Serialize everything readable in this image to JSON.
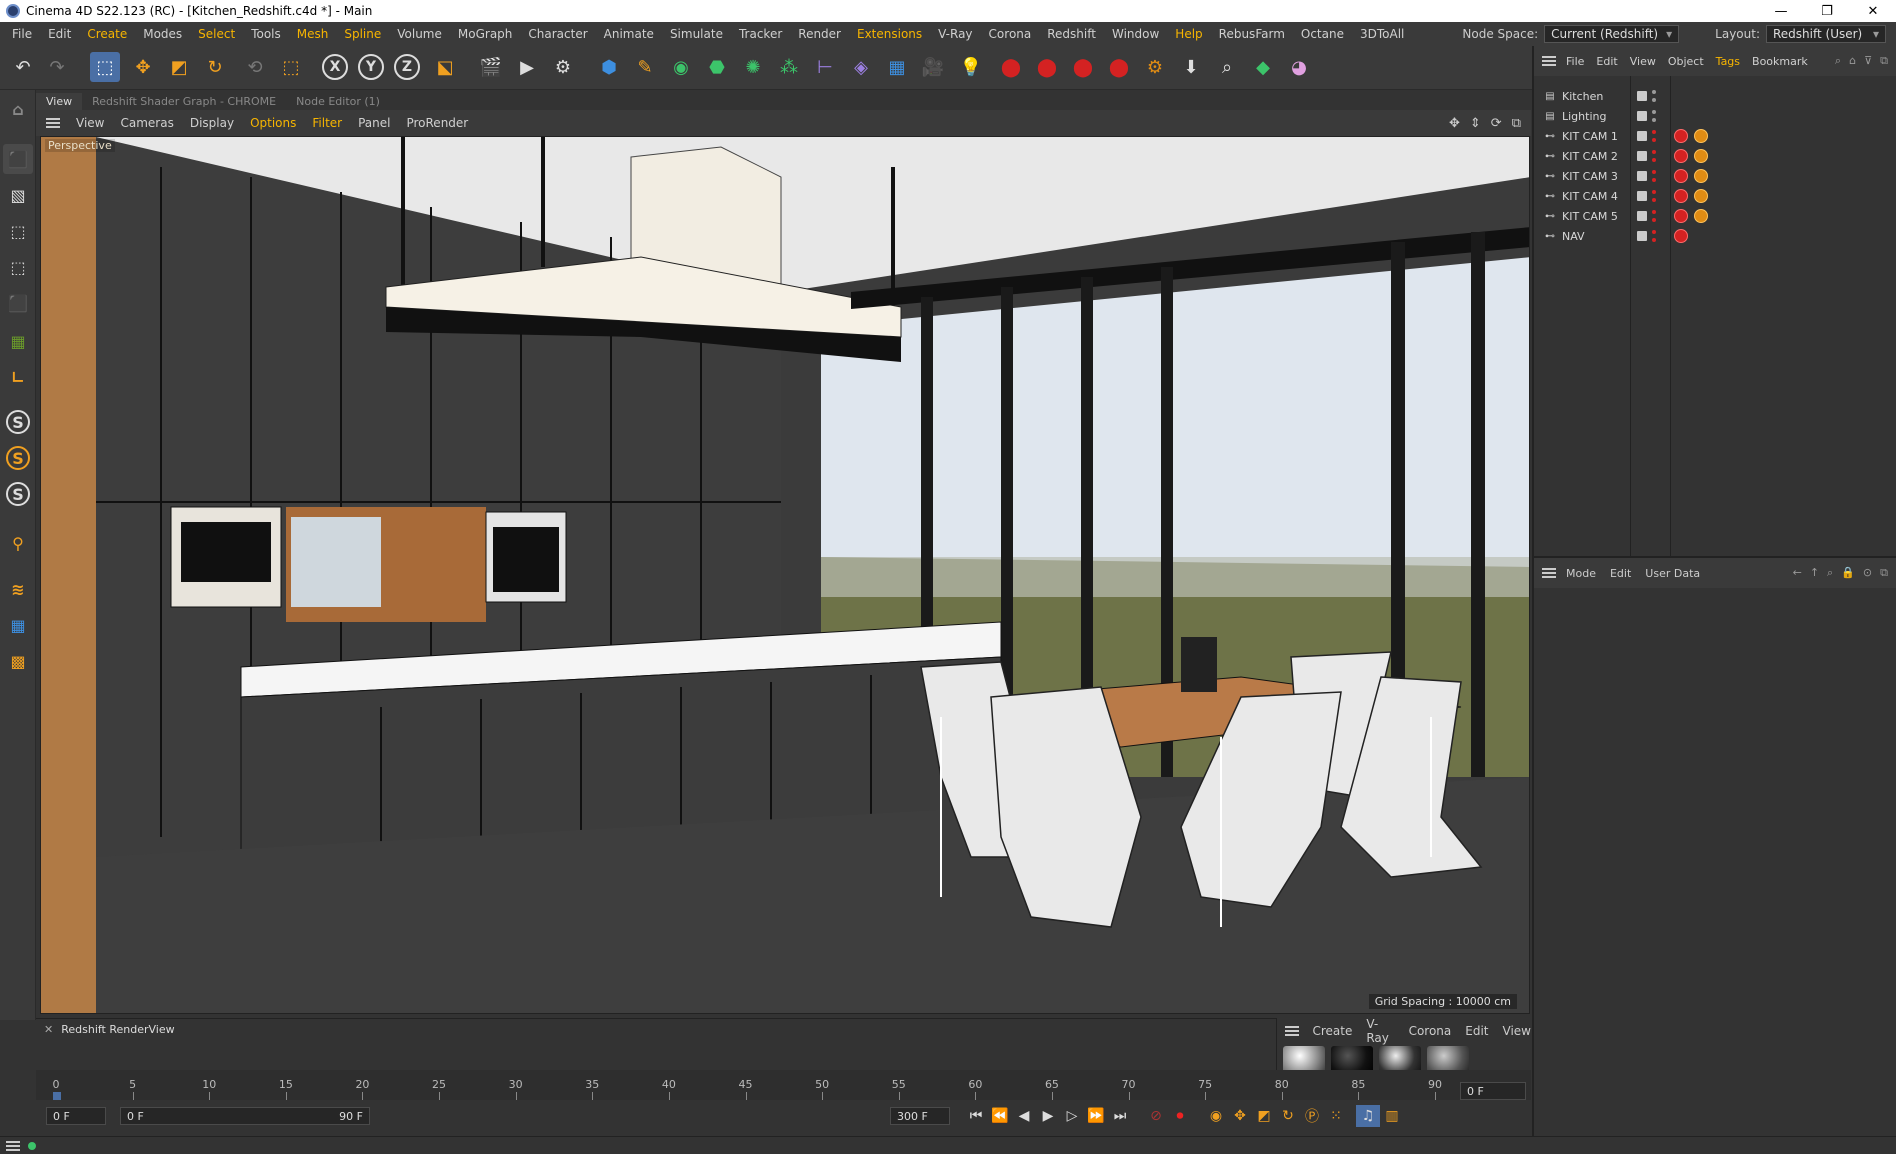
{
  "window": {
    "title": "Cinema 4D S22.123 (RC) - [Kitchen_Redshift.c4d *] - Main",
    "controls": [
      "—",
      "❐",
      "✕"
    ]
  },
  "menubar": {
    "items": [
      "File",
      "Edit",
      "Create",
      "Modes",
      "Select",
      "Tools",
      "Mesh",
      "Spline",
      "Volume",
      "MoGraph",
      "Character",
      "Animate",
      "Simulate",
      "Tracker",
      "Render",
      "Extensions",
      "V-Ray",
      "Corona",
      "Redshift",
      "Window",
      "Help",
      "RebusFarm",
      "Octane",
      "3DToAll"
    ],
    "node_space_label": "Node Space:",
    "node_space_value": "Current (Redshift)",
    "layout_label": "Layout:",
    "layout_value": "Redshift (User)"
  },
  "viewport_tabs": [
    "View",
    "Redshift Shader Graph - CHROME",
    "Node Editor (1)"
  ],
  "viewport_menu": [
    "View",
    "Cameras",
    "Display",
    "Options",
    "Filter",
    "Panel",
    "ProRender"
  ],
  "viewport": {
    "label": "Perspective",
    "grid_spacing": "Grid Spacing : 10000 cm"
  },
  "renderview": {
    "title": "Redshift RenderView",
    "close": "✕"
  },
  "material_menu": [
    "Create",
    "V-Ray",
    "Corona",
    "Edit",
    "View"
  ],
  "timeline": {
    "ticks": [
      "0",
      "5",
      "10",
      "15",
      "20",
      "25",
      "30",
      "35",
      "40",
      "45",
      "50",
      "55",
      "60",
      "65",
      "70",
      "75",
      "80",
      "85",
      "90"
    ],
    "current_frame_right": "0 F"
  },
  "playback": {
    "start_field": "0 F",
    "range_start": "0 F",
    "range_end": "90 F",
    "end_field": "300 F"
  },
  "object_manager": {
    "menu": [
      "File",
      "Edit",
      "View",
      "Object",
      "Tags",
      "Bookmark"
    ],
    "rows": [
      {
        "name": "Kitchen",
        "icon": "layer-icon",
        "tags": []
      },
      {
        "name": "Lighting",
        "icon": "layer-icon",
        "tags": []
      },
      {
        "name": "KIT CAM 1",
        "icon": "camera-icon",
        "tags": [
          "red",
          "orange"
        ]
      },
      {
        "name": "KIT CAM 2",
        "icon": "camera-icon",
        "tags": [
          "red",
          "orange"
        ]
      },
      {
        "name": "KIT CAM 3",
        "icon": "camera-icon",
        "tags": [
          "red",
          "orange"
        ]
      },
      {
        "name": "KIT CAM 4",
        "icon": "camera-icon",
        "tags": [
          "red",
          "orange"
        ]
      },
      {
        "name": "KIT CAM 5",
        "icon": "camera-icon",
        "tags": [
          "red",
          "orange"
        ]
      },
      {
        "name": "NAV",
        "icon": "camera-icon",
        "tags": [
          "red"
        ]
      }
    ]
  },
  "attribute_manager": {
    "menu": [
      "Mode",
      "Edit",
      "User Data"
    ]
  },
  "colors": {
    "accent": "#f7b500",
    "tag_red": "#d42222",
    "tag_orange": "#e08c14"
  }
}
